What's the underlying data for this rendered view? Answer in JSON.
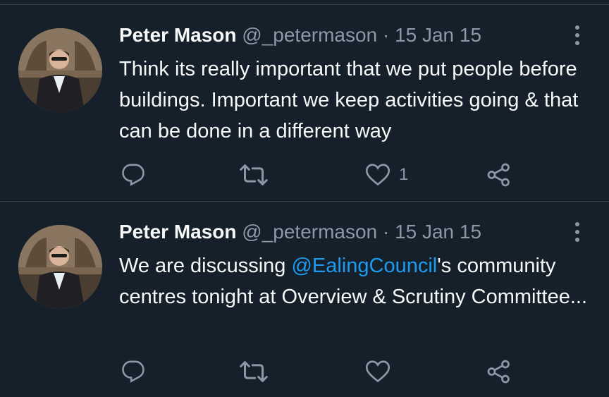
{
  "colors": {
    "background": "#15202b",
    "text": "#f7f9f9",
    "secondary": "#8b98a5",
    "link": "#1d9bf0",
    "divider": "#38444d"
  },
  "tweets": [
    {
      "name": "Peter Mason",
      "handle": "@_petermason",
      "separator": "·",
      "date": "15 Jan 15",
      "text_parts": [
        "Think its really important that we put people before buildings. Important we keep activities going & that can be done in a different way"
      ],
      "mention": "",
      "text_after": "",
      "reply_icon": "reply-icon",
      "retweet_icon": "retweet-icon",
      "like_icon": "heart-icon",
      "like_count": "1",
      "share_icon": "share-icon"
    },
    {
      "name": "Peter Mason",
      "handle": "@_petermason",
      "separator": "·",
      "date": "15 Jan 15",
      "text_before": "We are discussing ",
      "mention": "@EalingCouncil",
      "text_after": "'s community centres tonight at Overview & Scrutiny Committee...",
      "reply_icon": "reply-icon",
      "retweet_icon": "retweet-icon",
      "like_icon": "heart-icon",
      "like_count": "",
      "share_icon": "share-icon"
    }
  ]
}
